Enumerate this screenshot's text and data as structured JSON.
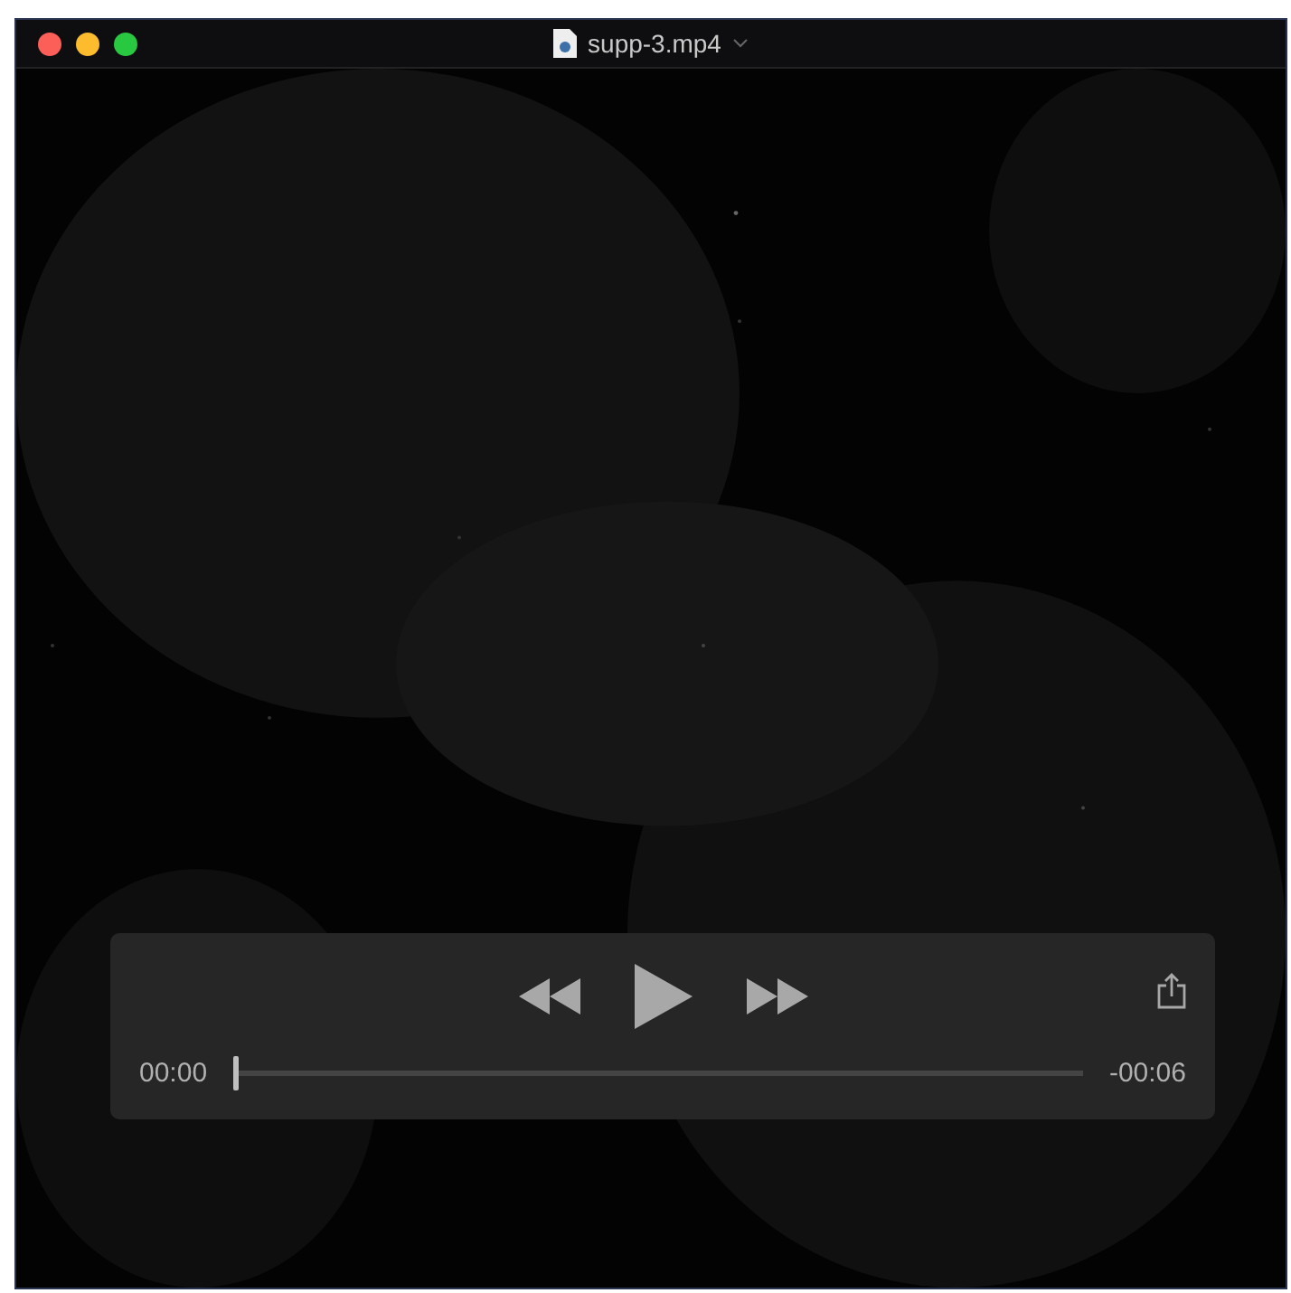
{
  "window": {
    "title": "supp-3.mp4"
  },
  "controls": {
    "elapsed": "00:00",
    "remaining": "-00:06",
    "progress": {
      "level": 0
    }
  }
}
